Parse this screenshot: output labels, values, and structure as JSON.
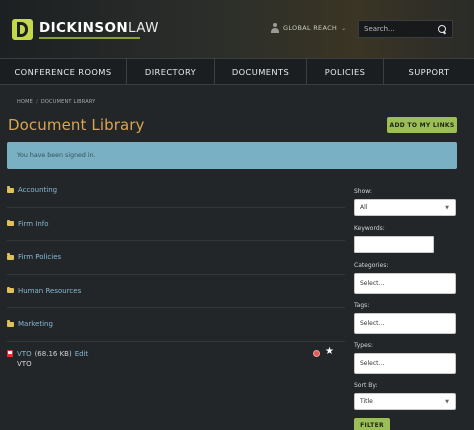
{
  "brand": {
    "name_bold": "DICKINSON",
    "name_light": "LAW"
  },
  "header": {
    "region_label": "GLOBAL REACH",
    "search_placeholder": "Search..."
  },
  "nav": {
    "items": [
      {
        "label": "CONFERENCE ROOMS"
      },
      {
        "label": "DIRECTORY"
      },
      {
        "label": "DOCUMENTS"
      },
      {
        "label": "POLICIES"
      },
      {
        "label": "SUPPORT"
      }
    ]
  },
  "breadcrumb": {
    "home": "HOME",
    "separator": "/",
    "current": "DOCUMENT LIBRARY"
  },
  "page": {
    "title": "Document Library",
    "add_links_label": "ADD TO MY LINKS",
    "alert": "You have been signed in."
  },
  "folders": [
    {
      "label": "Accounting"
    },
    {
      "label": "Firm Info"
    },
    {
      "label": "Firm Policies"
    },
    {
      "label": "Human Resources"
    },
    {
      "label": "Marketing"
    }
  ],
  "document": {
    "name": "VTO",
    "size": "(68.16 KB)",
    "edit_label": "Edit",
    "subtitle": "VTO"
  },
  "filters": {
    "show_label": "Show:",
    "show_value": "All",
    "keywords_label": "Keywords:",
    "categories_label": "Categories:",
    "categories_value": "Select...",
    "tags_label": "Tags:",
    "tags_value": "Select...",
    "types_label": "Types:",
    "types_value": "Select...",
    "sort_label": "Sort By:",
    "sort_value": "Title",
    "filter_button": "FILTER"
  },
  "colors": {
    "accent_green": "#9bbf56",
    "title_orange": "#d9a54e",
    "alert_blue": "#7ab0c4",
    "link_blue": "#86b9d4"
  }
}
